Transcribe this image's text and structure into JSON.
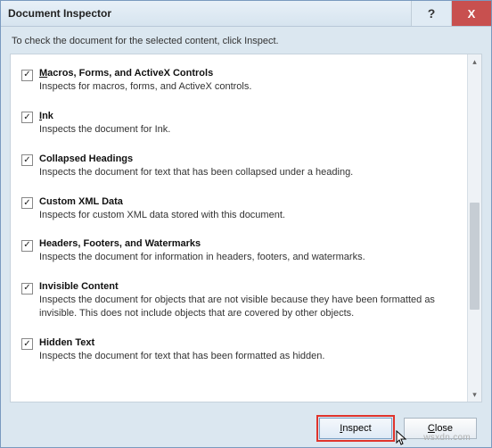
{
  "titlebar": {
    "title": "Document Inspector",
    "help": "?",
    "close": "X"
  },
  "instruction": "To check the document for the selected content, click Inspect.",
  "items": [
    {
      "title_a": "M",
      "title_b": "acros, Forms, and ActiveX Controls",
      "desc": "Inspects for macros, forms, and ActiveX controls."
    },
    {
      "title_a": "I",
      "title_b": "nk",
      "desc": "Inspects the document for Ink."
    },
    {
      "title_a": "",
      "title_b": "Collapsed Headings",
      "desc": "Inspects the document for text that has been collapsed under a heading."
    },
    {
      "title_a": "",
      "title_b": "Custom XML Data",
      "desc": "Inspects for custom XML data stored with this document."
    },
    {
      "title_a": "",
      "title_b": "Headers, Footers, and Watermarks",
      "desc": "Inspects the document for information in headers, footers, and watermarks."
    },
    {
      "title_a": "",
      "title_b": "Invisible Content",
      "desc": "Inspects the document for objects that are not visible because they have been formatted as invisible. This does not include objects that are covered by other objects."
    },
    {
      "title_a": "",
      "title_b": "Hidden Text",
      "desc": "Inspects the document for text that has been formatted as hidden."
    }
  ],
  "footer": {
    "inspect_a": "I",
    "inspect_b": "nspect",
    "close_a": "C",
    "close_b": "lose"
  },
  "watermark": "wsxdn.com"
}
